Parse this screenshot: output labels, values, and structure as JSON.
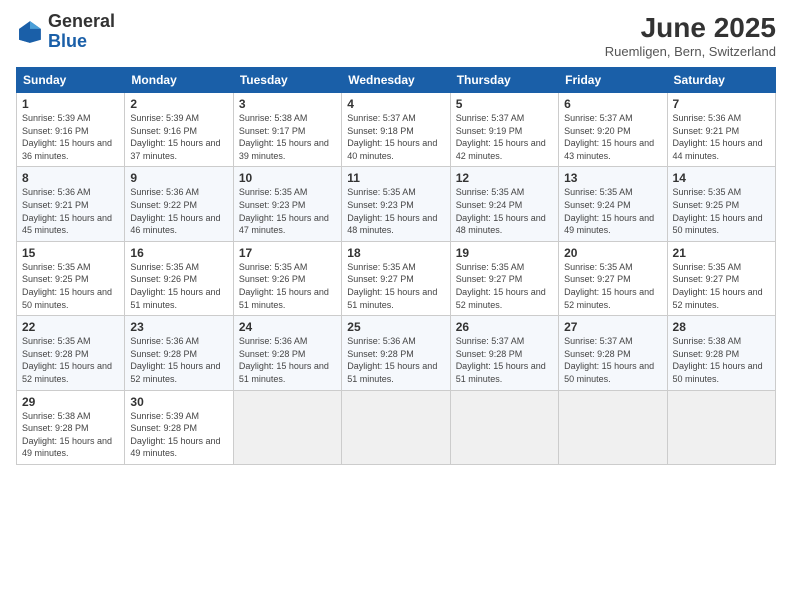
{
  "header": {
    "logo_general": "General",
    "logo_blue": "Blue",
    "month_title": "June 2025",
    "location": "Ruemligen, Bern, Switzerland"
  },
  "weekdays": [
    "Sunday",
    "Monday",
    "Tuesday",
    "Wednesday",
    "Thursday",
    "Friday",
    "Saturday"
  ],
  "weeks": [
    [
      {
        "day": "1",
        "sunrise": "Sunrise: 5:39 AM",
        "sunset": "Sunset: 9:16 PM",
        "daylight": "Daylight: 15 hours and 36 minutes."
      },
      {
        "day": "2",
        "sunrise": "Sunrise: 5:39 AM",
        "sunset": "Sunset: 9:16 PM",
        "daylight": "Daylight: 15 hours and 37 minutes."
      },
      {
        "day": "3",
        "sunrise": "Sunrise: 5:38 AM",
        "sunset": "Sunset: 9:17 PM",
        "daylight": "Daylight: 15 hours and 39 minutes."
      },
      {
        "day": "4",
        "sunrise": "Sunrise: 5:37 AM",
        "sunset": "Sunset: 9:18 PM",
        "daylight": "Daylight: 15 hours and 40 minutes."
      },
      {
        "day": "5",
        "sunrise": "Sunrise: 5:37 AM",
        "sunset": "Sunset: 9:19 PM",
        "daylight": "Daylight: 15 hours and 42 minutes."
      },
      {
        "day": "6",
        "sunrise": "Sunrise: 5:37 AM",
        "sunset": "Sunset: 9:20 PM",
        "daylight": "Daylight: 15 hours and 43 minutes."
      },
      {
        "day": "7",
        "sunrise": "Sunrise: 5:36 AM",
        "sunset": "Sunset: 9:21 PM",
        "daylight": "Daylight: 15 hours and 44 minutes."
      }
    ],
    [
      {
        "day": "8",
        "sunrise": "Sunrise: 5:36 AM",
        "sunset": "Sunset: 9:21 PM",
        "daylight": "Daylight: 15 hours and 45 minutes."
      },
      {
        "day": "9",
        "sunrise": "Sunrise: 5:36 AM",
        "sunset": "Sunset: 9:22 PM",
        "daylight": "Daylight: 15 hours and 46 minutes."
      },
      {
        "day": "10",
        "sunrise": "Sunrise: 5:35 AM",
        "sunset": "Sunset: 9:23 PM",
        "daylight": "Daylight: 15 hours and 47 minutes."
      },
      {
        "day": "11",
        "sunrise": "Sunrise: 5:35 AM",
        "sunset": "Sunset: 9:23 PM",
        "daylight": "Daylight: 15 hours and 48 minutes."
      },
      {
        "day": "12",
        "sunrise": "Sunrise: 5:35 AM",
        "sunset": "Sunset: 9:24 PM",
        "daylight": "Daylight: 15 hours and 48 minutes."
      },
      {
        "day": "13",
        "sunrise": "Sunrise: 5:35 AM",
        "sunset": "Sunset: 9:24 PM",
        "daylight": "Daylight: 15 hours and 49 minutes."
      },
      {
        "day": "14",
        "sunrise": "Sunrise: 5:35 AM",
        "sunset": "Sunset: 9:25 PM",
        "daylight": "Daylight: 15 hours and 50 minutes."
      }
    ],
    [
      {
        "day": "15",
        "sunrise": "Sunrise: 5:35 AM",
        "sunset": "Sunset: 9:25 PM",
        "daylight": "Daylight: 15 hours and 50 minutes."
      },
      {
        "day": "16",
        "sunrise": "Sunrise: 5:35 AM",
        "sunset": "Sunset: 9:26 PM",
        "daylight": "Daylight: 15 hours and 51 minutes."
      },
      {
        "day": "17",
        "sunrise": "Sunrise: 5:35 AM",
        "sunset": "Sunset: 9:26 PM",
        "daylight": "Daylight: 15 hours and 51 minutes."
      },
      {
        "day": "18",
        "sunrise": "Sunrise: 5:35 AM",
        "sunset": "Sunset: 9:27 PM",
        "daylight": "Daylight: 15 hours and 51 minutes."
      },
      {
        "day": "19",
        "sunrise": "Sunrise: 5:35 AM",
        "sunset": "Sunset: 9:27 PM",
        "daylight": "Daylight: 15 hours and 52 minutes."
      },
      {
        "day": "20",
        "sunrise": "Sunrise: 5:35 AM",
        "sunset": "Sunset: 9:27 PM",
        "daylight": "Daylight: 15 hours and 52 minutes."
      },
      {
        "day": "21",
        "sunrise": "Sunrise: 5:35 AM",
        "sunset": "Sunset: 9:27 PM",
        "daylight": "Daylight: 15 hours and 52 minutes."
      }
    ],
    [
      {
        "day": "22",
        "sunrise": "Sunrise: 5:35 AM",
        "sunset": "Sunset: 9:28 PM",
        "daylight": "Daylight: 15 hours and 52 minutes."
      },
      {
        "day": "23",
        "sunrise": "Sunrise: 5:36 AM",
        "sunset": "Sunset: 9:28 PM",
        "daylight": "Daylight: 15 hours and 52 minutes."
      },
      {
        "day": "24",
        "sunrise": "Sunrise: 5:36 AM",
        "sunset": "Sunset: 9:28 PM",
        "daylight": "Daylight: 15 hours and 51 minutes."
      },
      {
        "day": "25",
        "sunrise": "Sunrise: 5:36 AM",
        "sunset": "Sunset: 9:28 PM",
        "daylight": "Daylight: 15 hours and 51 minutes."
      },
      {
        "day": "26",
        "sunrise": "Sunrise: 5:37 AM",
        "sunset": "Sunset: 9:28 PM",
        "daylight": "Daylight: 15 hours and 51 minutes."
      },
      {
        "day": "27",
        "sunrise": "Sunrise: 5:37 AM",
        "sunset": "Sunset: 9:28 PM",
        "daylight": "Daylight: 15 hours and 50 minutes."
      },
      {
        "day": "28",
        "sunrise": "Sunrise: 5:38 AM",
        "sunset": "Sunset: 9:28 PM",
        "daylight": "Daylight: 15 hours and 50 minutes."
      }
    ],
    [
      {
        "day": "29",
        "sunrise": "Sunrise: 5:38 AM",
        "sunset": "Sunset: 9:28 PM",
        "daylight": "Daylight: 15 hours and 49 minutes."
      },
      {
        "day": "30",
        "sunrise": "Sunrise: 5:39 AM",
        "sunset": "Sunset: 9:28 PM",
        "daylight": "Daylight: 15 hours and 49 minutes."
      },
      {
        "day": "",
        "sunrise": "",
        "sunset": "",
        "daylight": ""
      },
      {
        "day": "",
        "sunrise": "",
        "sunset": "",
        "daylight": ""
      },
      {
        "day": "",
        "sunrise": "",
        "sunset": "",
        "daylight": ""
      },
      {
        "day": "",
        "sunrise": "",
        "sunset": "",
        "daylight": ""
      },
      {
        "day": "",
        "sunrise": "",
        "sunset": "",
        "daylight": ""
      }
    ]
  ]
}
